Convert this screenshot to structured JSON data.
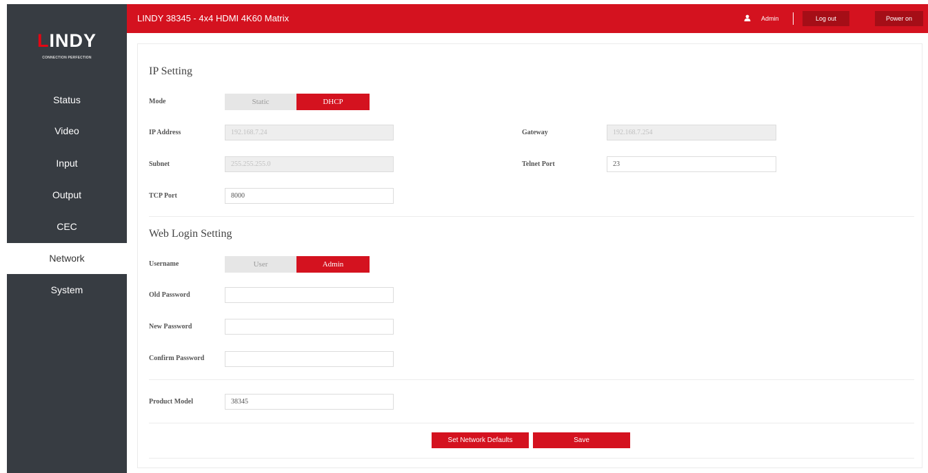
{
  "header": {
    "title": "LINDY 38345 - 4x4 HDMI 4K60 Matrix",
    "user": "Admin",
    "logout_label": "Log out",
    "power_label": "Power on"
  },
  "brand": {
    "name_rest": "INDY",
    "tagline": "CONNECTION PERFECTION"
  },
  "sidebar": {
    "items": [
      {
        "label": "Status"
      },
      {
        "label": "Video"
      },
      {
        "label": "Input"
      },
      {
        "label": "Output"
      },
      {
        "label": "CEC"
      },
      {
        "label": "Network",
        "active": true
      },
      {
        "label": "System"
      }
    ]
  },
  "ip_setting": {
    "title": "IP Setting",
    "mode_label": "Mode",
    "mode_options": [
      "Static",
      "DHCP"
    ],
    "mode_selected": "DHCP",
    "ip_label": "IP Address",
    "ip_value": "192.168.7.24",
    "gateway_label": "Gateway",
    "gateway_value": "192.168.7.254",
    "subnet_label": "Subnet",
    "subnet_value": "255.255.255.0",
    "telnet_label": "Telnet Port",
    "telnet_value": "23",
    "tcp_label": "TCP Port",
    "tcp_value": "8000"
  },
  "web_login": {
    "title": "Web Login Setting",
    "username_label": "Username",
    "user_options": [
      "User",
      "Admin"
    ],
    "user_selected": "Admin",
    "old_pw_label": "Old Password",
    "new_pw_label": "New Password",
    "confirm_pw_label": "Confirm Password"
  },
  "product": {
    "label": "Product Model",
    "value": "38345"
  },
  "actions": {
    "defaults_label": "Set Network Defaults",
    "save_label": "Save"
  },
  "colors": {
    "accent": "#d4121f",
    "sidebar": "#373c42"
  }
}
